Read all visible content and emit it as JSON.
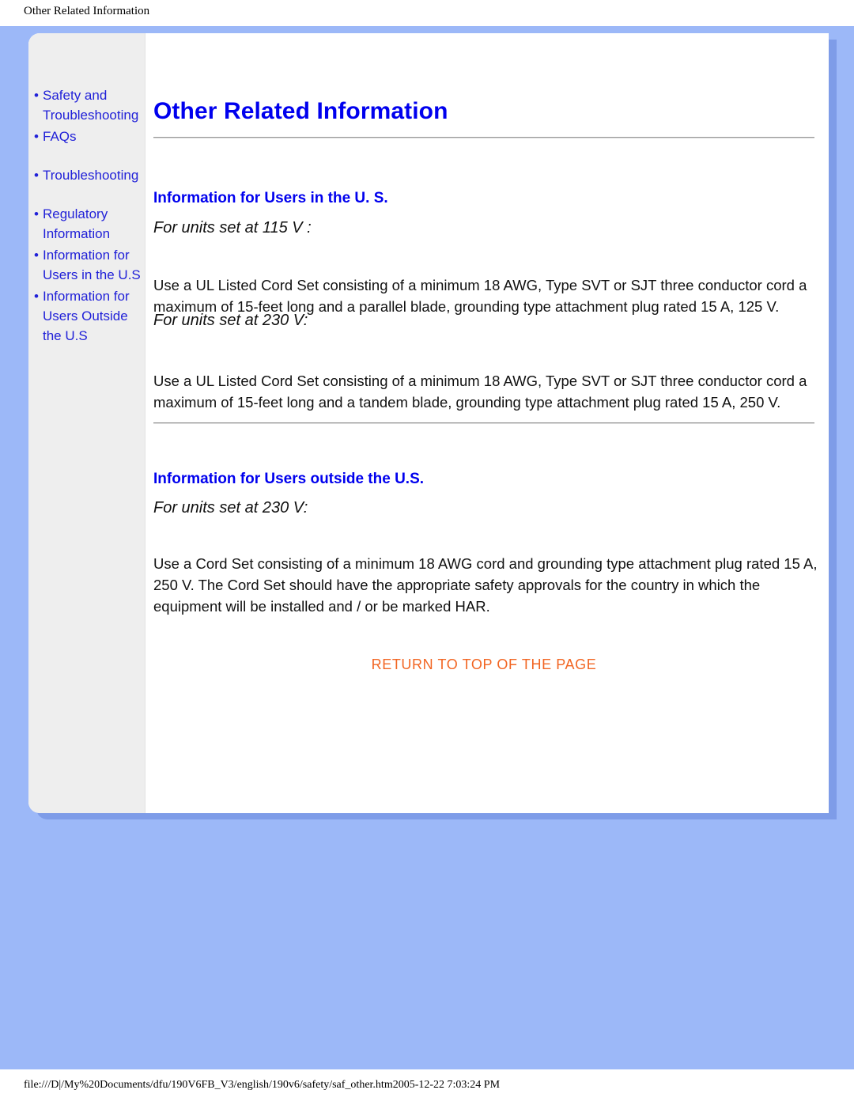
{
  "browser": {
    "print_header_title": "Other Related Information",
    "footer_url": "file:///D|/My%20Documents/dfu/190V6FB_V3/english/190v6/safety/saf_other.htm2005-12-22 7:03:24 PM"
  },
  "colors": {
    "link_blue": "#2121d8",
    "heading_blue": "#0000ee",
    "return_orange": "#f26522",
    "page_blue": "#9cb8f8",
    "sidebar_gray": "#eeeeee"
  },
  "sidebar": {
    "groups": [
      {
        "items": [
          {
            "label": "Safety and Troubleshooting",
            "bullet": "•"
          },
          {
            "label": "FAQs",
            "bullet": "•"
          }
        ]
      },
      {
        "items": [
          {
            "label": "Troubleshooting",
            "bullet": "•"
          }
        ]
      },
      {
        "items": [
          {
            "label": "Regulatory Information",
            "bullet": "•"
          },
          {
            "label": "Information for Users in the U.S",
            "bullet": "•"
          },
          {
            "label": "Information for Users Outside the U.S",
            "bullet": "•"
          }
        ]
      }
    ]
  },
  "main": {
    "page_title": "Other Related Information",
    "sections": [
      {
        "heading": "Information for Users in the U. S.",
        "blocks": [
          {
            "subheading": "For units set at 115 V :",
            "body": "Use a UL Listed Cord Set consisting of a minimum 18 AWG, Type SVT or SJT three conductor cord a maximum of 15-feet long and a parallel blade, grounding type attachment plug rated 15 A, 125 V."
          },
          {
            "subheading": "For units set at 230 V:",
            "body": "Use a UL Listed Cord Set consisting of a minimum 18 AWG, Type SVT or SJT three conductor cord a maximum of 15-feet long and a tandem blade, grounding type attachment plug rated 15 A, 250 V."
          }
        ]
      },
      {
        "heading": "Information for Users outside the U.S.",
        "blocks": [
          {
            "subheading": "For units set at 230 V:",
            "body": "Use a Cord Set consisting of a minimum 18 AWG cord and grounding type attachment plug rated 15 A, 250 V. The Cord Set should have the appropriate safety approvals for the country in which the equipment will be installed and / or be marked HAR."
          }
        ]
      }
    ],
    "return_to_top_label": "RETURN TO TOP OF THE PAGE"
  }
}
